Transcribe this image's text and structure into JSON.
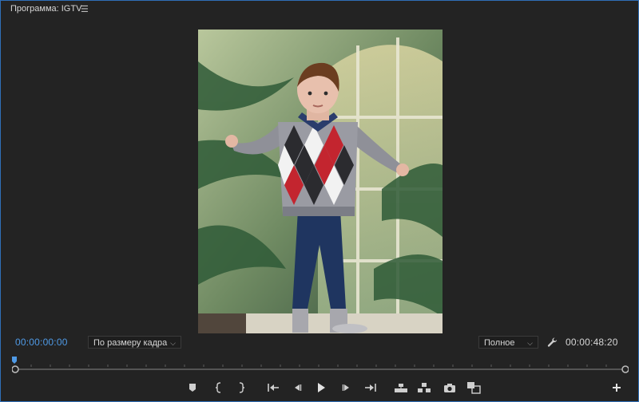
{
  "panel": {
    "title": "Программа: IGTV",
    "menu_icon": "hamburger-icon",
    "accent": "#2f6fb8"
  },
  "viewer": {
    "content": "video-frame",
    "image_description_icon": "video-preview"
  },
  "timecode": {
    "current": "00:00:00:00",
    "duration": "00:00:48:20",
    "current_color": "#4f9ae6"
  },
  "fit_dropdown": {
    "value": "По размеру кадра"
  },
  "quality_dropdown": {
    "value": "Полное"
  },
  "controls": [
    "add-marker-icon",
    "mark-in-icon",
    "mark-out-icon",
    "go-to-in-icon",
    "step-back-icon",
    "play-icon",
    "step-forward-icon",
    "go-to-out-icon",
    "lift-icon",
    "extract-icon",
    "export-frame-icon",
    "comparison-view-icon",
    "add-button-icon"
  ]
}
